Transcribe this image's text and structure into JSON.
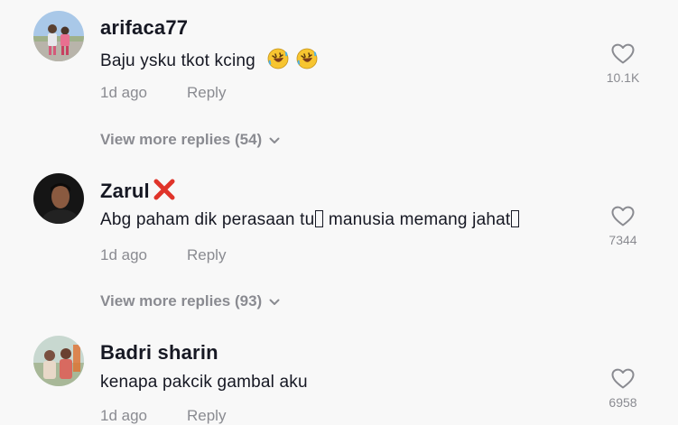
{
  "comments": [
    {
      "username": "arifaca77",
      "text": "Baju ysku tkot kcing",
      "emojis": [
        "rolling-on-floor-laughing-icon",
        "rolling-on-floor-laughing-icon"
      ],
      "time": "1d ago",
      "reply_label": "Reply",
      "likes": "10.1K",
      "view_more": "View more replies (54)"
    },
    {
      "username": "Zarul",
      "username_badge": "cross-mark-icon",
      "text_part1": "Abg paham dik perasaan tu",
      "text_part2": " manusia memang jahat",
      "time": "1d ago",
      "reply_label": "Reply",
      "likes": "7344",
      "view_more": "View more replies (93)"
    },
    {
      "username": "Badri sharin",
      "text": "kenapa pakcik gambal aku",
      "time": "1d ago",
      "reply_label": "Reply",
      "likes": "6958"
    }
  ],
  "colors": {
    "background": "#f8f8f8",
    "primary_text": "#161823",
    "secondary_text": "#8a8b91",
    "badge_red": "#e0342a"
  }
}
